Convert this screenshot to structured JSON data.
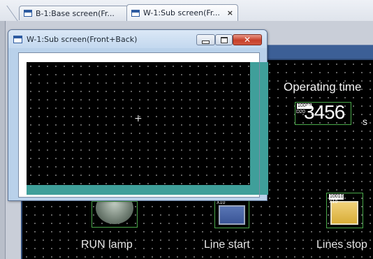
{
  "tabs": [
    {
      "label": "B-1:Base screen(Fr...",
      "close": "×",
      "active": false
    },
    {
      "label": "W-1:Sub screen(Fr...",
      "close": "×",
      "active": true
    }
  ],
  "canvas": {
    "operating_time_label": "Operating time",
    "numeric_display": {
      "device_tag": "10003",
      "device_id": "D20",
      "value": "3456",
      "unit": "s"
    },
    "run_lamp_label": "RUN lamp",
    "line_start_label": "Line start",
    "line_start_tag": "X10",
    "lines_stop_label": "Lines stop",
    "lines_stop_tag1": "10010",
    "lines_stop_tag2": "X10"
  },
  "subwindow": {
    "title": "W-1:Sub screen(Front+Back)",
    "crosshair": "+",
    "close_glyph": "✕"
  },
  "colors": {
    "canvas_bg": "#000000",
    "sub_screen_border": "#3f9f9a",
    "selection_outline": "#4aa84a",
    "line_start_button": "#3a5596",
    "lines_stop_button": "#d8ad37"
  }
}
